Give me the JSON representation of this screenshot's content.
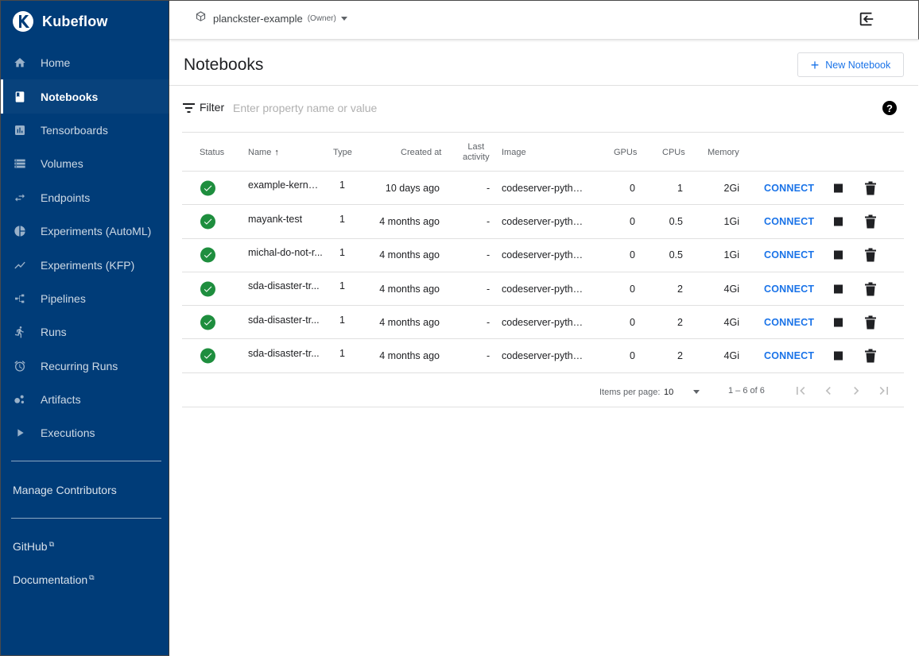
{
  "app": {
    "name": "Kubeflow"
  },
  "sidebar": {
    "items": [
      {
        "label": "Home",
        "icon": "home-icon",
        "active": false
      },
      {
        "label": "Notebooks",
        "icon": "notebook-icon",
        "active": true
      },
      {
        "label": "Tensorboards",
        "icon": "tensorboard-icon",
        "active": false
      },
      {
        "label": "Volumes",
        "icon": "volumes-icon",
        "active": false
      },
      {
        "label": "Endpoints",
        "icon": "endpoints-icon",
        "active": false
      },
      {
        "label": "Experiments (AutoML)",
        "icon": "automl-icon",
        "active": false
      },
      {
        "label": "Experiments (KFP)",
        "icon": "kfp-icon",
        "active": false
      },
      {
        "label": "Pipelines",
        "icon": "pipelines-icon",
        "active": false
      },
      {
        "label": "Runs",
        "icon": "runs-icon",
        "active": false
      },
      {
        "label": "Recurring Runs",
        "icon": "alarm-icon",
        "active": false
      },
      {
        "label": "Artifacts",
        "icon": "artifacts-icon",
        "active": false
      },
      {
        "label": "Executions",
        "icon": "play-icon",
        "active": false
      }
    ],
    "manage_contributors": "Manage Contributors",
    "github": "GitHub",
    "documentation": "Documentation"
  },
  "topbar": {
    "namespace": "planckster-example",
    "role": "(Owner)"
  },
  "page": {
    "title": "Notebooks",
    "new_button": "New Notebook"
  },
  "filter": {
    "label": "Filter",
    "placeholder": "Enter property name or value"
  },
  "table": {
    "headers": {
      "status": "Status",
      "name": "Name",
      "type": "Type",
      "created": "Created at",
      "last_activity_1": "Last",
      "last_activity_2": "activity",
      "image": "Image",
      "gpus": "GPUs",
      "cpus": "CPUs",
      "memory": "Memory"
    },
    "rows": [
      {
        "name": "example-kernel...",
        "type": "1",
        "created": "10 days ago",
        "last": "-",
        "image": "codeserver-pytho...",
        "gpus": "0",
        "cpus": "1",
        "memory": "2Gi",
        "action": "CONNECT"
      },
      {
        "name": "mayank-test",
        "type": "1",
        "created": "4 months ago",
        "last": "-",
        "image": "codeserver-pytho...",
        "gpus": "0",
        "cpus": "0.5",
        "memory": "1Gi",
        "action": "CONNECT"
      },
      {
        "name": "michal-do-not-r...",
        "type": "1",
        "created": "4 months ago",
        "last": "-",
        "image": "codeserver-pytho...",
        "gpus": "0",
        "cpus": "0.5",
        "memory": "1Gi",
        "action": "CONNECT"
      },
      {
        "name": "sda-disaster-tr...",
        "type": "1",
        "created": "4 months ago",
        "last": "-",
        "image": "codeserver-pytho...",
        "gpus": "0",
        "cpus": "2",
        "memory": "4Gi",
        "action": "CONNECT"
      },
      {
        "name": "sda-disaster-tr...",
        "type": "1",
        "created": "4 months ago",
        "last": "-",
        "image": "codeserver-pytho...",
        "gpus": "0",
        "cpus": "2",
        "memory": "4Gi",
        "action": "CONNECT"
      },
      {
        "name": "sda-disaster-tr...",
        "type": "1",
        "created": "4 months ago",
        "last": "-",
        "image": "codeserver-pytho...",
        "gpus": "0",
        "cpus": "2",
        "memory": "4Gi",
        "action": "CONNECT"
      }
    ]
  },
  "paginator": {
    "label": "Items per page:",
    "page_size": "10",
    "range": "1 – 6 of 6"
  },
  "colors": {
    "sidebar_bg": "#003c78",
    "accent": "#1a73e8",
    "status_ok": "#1e8e3e"
  }
}
